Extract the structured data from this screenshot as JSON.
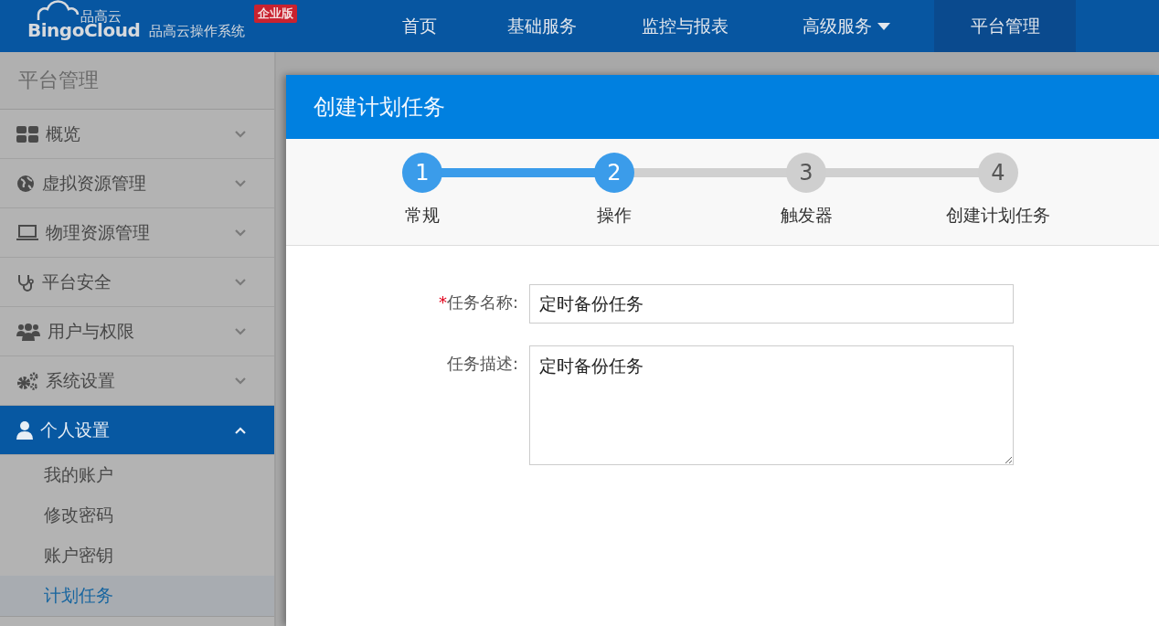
{
  "header": {
    "logo_cn": "品高云",
    "logo_en": "BingoCloud",
    "product": "品高云操作系统",
    "edition_badge": "企业版",
    "nav": [
      {
        "label": "首页",
        "selected": false,
        "has_dropdown": false
      },
      {
        "label": "基础服务",
        "selected": false,
        "has_dropdown": false
      },
      {
        "label": "监控与报表",
        "selected": false,
        "has_dropdown": false
      },
      {
        "label": "高级服务",
        "selected": false,
        "has_dropdown": true
      },
      {
        "label": "平台管理",
        "selected": true,
        "has_dropdown": false
      }
    ]
  },
  "sidebar": {
    "title": "平台管理",
    "items": [
      {
        "label": "概览",
        "expanded": false
      },
      {
        "label": "虚拟资源管理",
        "expanded": false
      },
      {
        "label": "物理资源管理",
        "expanded": false
      },
      {
        "label": "平台安全",
        "expanded": false
      },
      {
        "label": "用户与权限",
        "expanded": false
      },
      {
        "label": "系统设置",
        "expanded": false
      },
      {
        "label": "个人设置",
        "expanded": true,
        "children": [
          {
            "label": "我的账户",
            "selected": false
          },
          {
            "label": "修改密码",
            "selected": false
          },
          {
            "label": "账户密钥",
            "selected": false
          },
          {
            "label": "计划任务",
            "selected": true
          }
        ]
      }
    ]
  },
  "dialog": {
    "title": "创建计划任务",
    "steps": [
      {
        "number": "1",
        "label": "常规",
        "reached": true
      },
      {
        "number": "2",
        "label": "操作",
        "reached": true
      },
      {
        "number": "3",
        "label": "触发器",
        "reached": false
      },
      {
        "number": "4",
        "label": "创建计划任务",
        "reached": false
      }
    ],
    "fields": [
      {
        "kind": "input",
        "required_mark": "*",
        "label": "任务名称:",
        "value": "定时备份任务"
      },
      {
        "kind": "textarea",
        "label": "任务描述:",
        "value": "定时备份任务"
      }
    ]
  }
}
